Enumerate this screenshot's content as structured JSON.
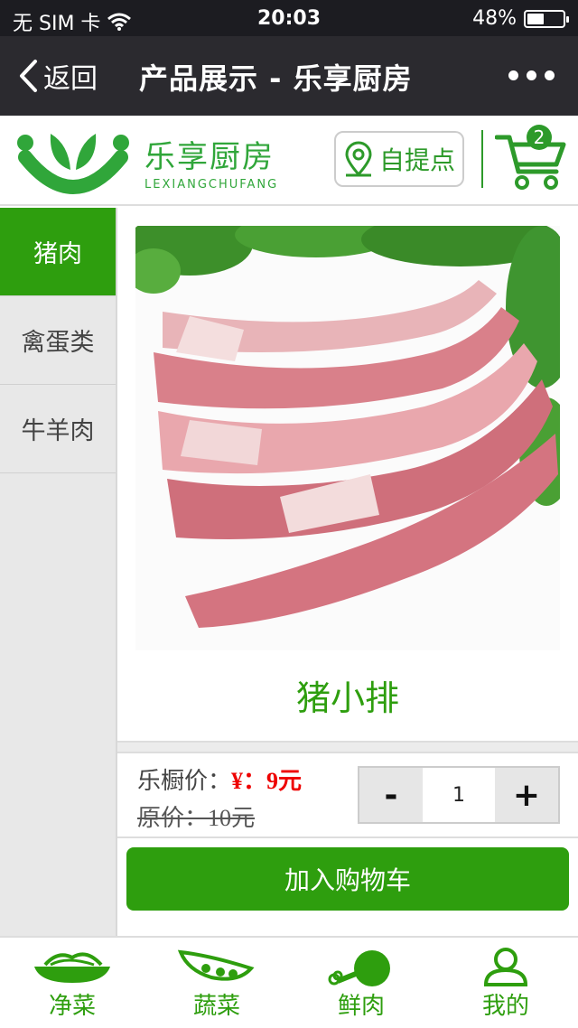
{
  "status_bar": {
    "carrier": "无 SIM 卡",
    "time": "20:03",
    "battery": "48%",
    "battery_level": 0.48
  },
  "nav": {
    "back_label": "返回",
    "title": "产品展示 - 乐享厨房"
  },
  "header": {
    "logo_cn": "乐享厨房",
    "logo_en": "LEXIANGCHUFANG",
    "pickup_label": "自提点",
    "cart_count": "2"
  },
  "categories": [
    {
      "label": "猪肉",
      "active": true
    },
    {
      "label": "禽蛋类",
      "active": false
    },
    {
      "label": "牛羊肉",
      "active": false
    }
  ],
  "product": {
    "name": "猪小排",
    "price_label": "乐橱价：",
    "price_value": "¥：9元",
    "original_price": "原价：10元",
    "quantity": "1",
    "minus": "-",
    "plus": "+",
    "add_to_cart": "加入购物车"
  },
  "tabs": [
    {
      "label": "净菜",
      "icon": "bowl-icon"
    },
    {
      "label": "蔬菜",
      "icon": "peapod-icon"
    },
    {
      "label": "鲜肉",
      "icon": "drumstick-icon"
    },
    {
      "label": "我的",
      "icon": "user-icon"
    }
  ],
  "colors": {
    "brand_green": "#2e9e0e",
    "price_red": "#ee0000",
    "nav_bg": "#2b2a2f"
  }
}
